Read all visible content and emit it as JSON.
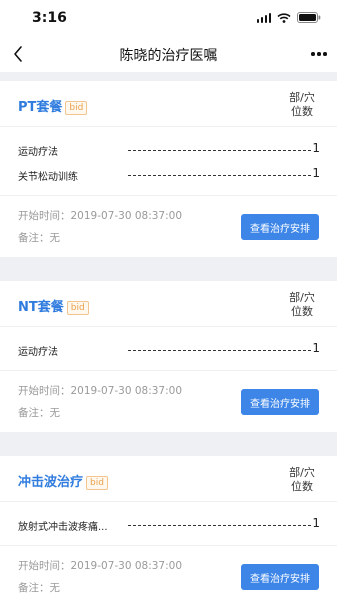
{
  "status_bar": {
    "time": "3:16"
  },
  "nav": {
    "title": "陈晓的治疗医嘱"
  },
  "unit_label_line1": "部/穴",
  "unit_label_line2": "位数",
  "badge": "bid",
  "colors": {
    "accent": "#2f7cde",
    "button": "#3d86e8",
    "badge": "#e9a14f"
  },
  "packages": [
    {
      "name": "PT套餐",
      "items": [
        {
          "name": "运动疗法",
          "count": "1"
        },
        {
          "name": "关节松动训练",
          "count": "1"
        }
      ],
      "start_time": "开始时间：2019-07-30 08:37:00",
      "remark": "备注：无",
      "button": "查看治疗安排"
    },
    {
      "name": "NT套餐",
      "items": [
        {
          "name": "运动疗法",
          "count": "1"
        }
      ],
      "start_time": "开始时间：2019-07-30 08:37:00",
      "remark": "备注：无",
      "button": "查看治疗安排"
    },
    {
      "name": "冲击波治疗",
      "items": [
        {
          "name": "放射式冲击波疼痛...",
          "count": "1"
        }
      ],
      "start_time": "开始时间：2019-07-30 08:37:00",
      "remark": "备注：无",
      "button": "查看治疗安排"
    }
  ]
}
